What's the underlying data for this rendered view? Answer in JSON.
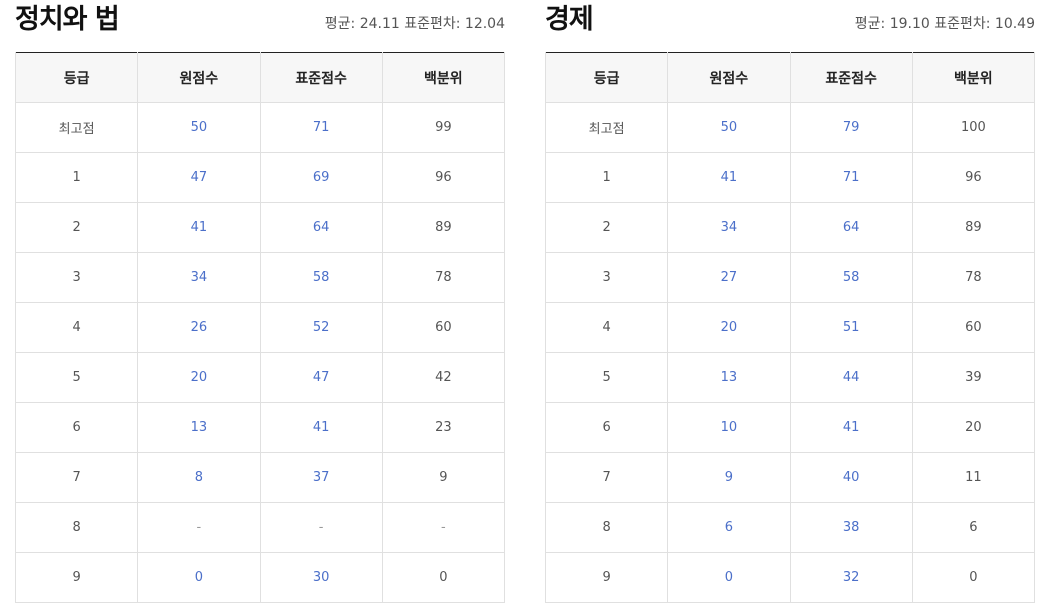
{
  "headers": [
    "등급",
    "원점수",
    "표준점수",
    "백분위"
  ],
  "panels": [
    {
      "title": "정치와 법",
      "stats": "평균: 24.11 표준편차: 12.04",
      "rows": [
        [
          "최고점",
          "50",
          "71",
          "99"
        ],
        [
          "1",
          "47",
          "69",
          "96"
        ],
        [
          "2",
          "41",
          "64",
          "89"
        ],
        [
          "3",
          "34",
          "58",
          "78"
        ],
        [
          "4",
          "26",
          "52",
          "60"
        ],
        [
          "5",
          "20",
          "47",
          "42"
        ],
        [
          "6",
          "13",
          "41",
          "23"
        ],
        [
          "7",
          "8",
          "37",
          "9"
        ],
        [
          "8",
          "-",
          "-",
          "-"
        ],
        [
          "9",
          "0",
          "30",
          "0"
        ]
      ]
    },
    {
      "title": "경제",
      "stats": "평균: 19.10 표준편차: 10.49",
      "rows": [
        [
          "최고점",
          "50",
          "79",
          "100"
        ],
        [
          "1",
          "41",
          "71",
          "96"
        ],
        [
          "2",
          "34",
          "64",
          "89"
        ],
        [
          "3",
          "27",
          "58",
          "78"
        ],
        [
          "4",
          "20",
          "51",
          "60"
        ],
        [
          "5",
          "13",
          "44",
          "39"
        ],
        [
          "6",
          "10",
          "41",
          "20"
        ],
        [
          "7",
          "9",
          "40",
          "11"
        ],
        [
          "8",
          "6",
          "38",
          "6"
        ],
        [
          "9",
          "0",
          "32",
          "0"
        ]
      ]
    }
  ],
  "colors": {
    "link_blue": "#4b6fc9",
    "text_gray": "#555555",
    "header_bg": "#f7f7f7"
  }
}
